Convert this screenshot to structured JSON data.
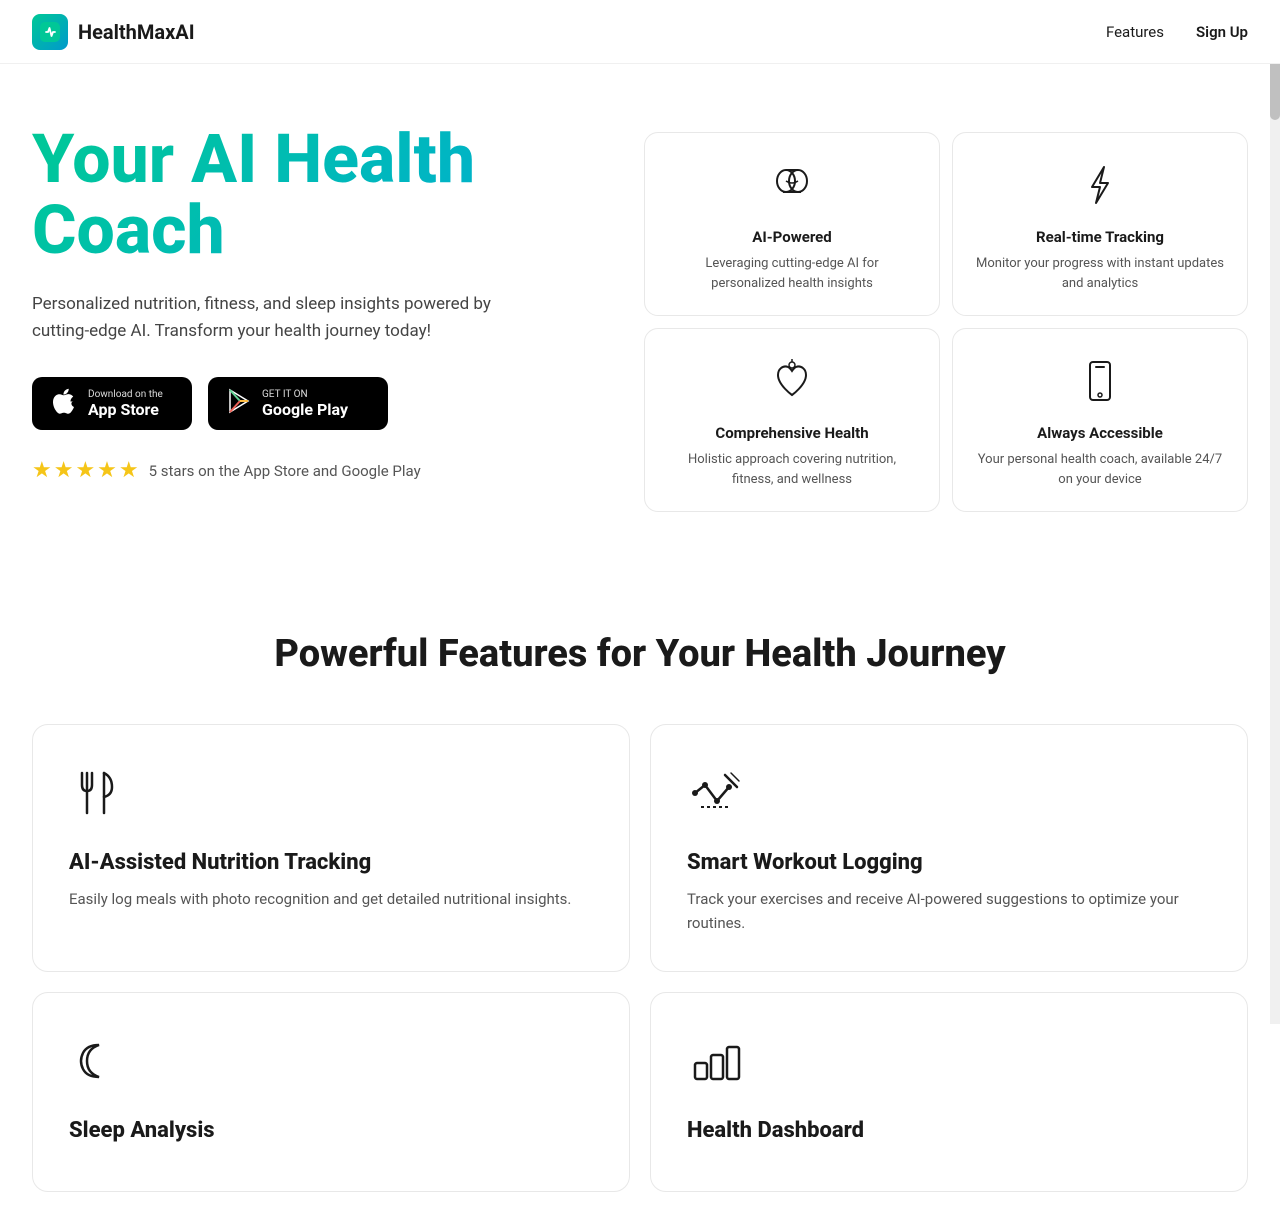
{
  "nav": {
    "logo_icon": "✦",
    "logo_text": "HealthMaxAI",
    "links": [
      {
        "label": "Features",
        "id": "nav-features"
      },
      {
        "label": "Sign Up",
        "id": "nav-signup"
      }
    ]
  },
  "hero": {
    "title": "Your AI Health Coach",
    "description": "Personalized nutrition, fitness, and sleep insights powered by cutting-edge AI. Transform your health journey today!",
    "appstore_sub": "Download on the",
    "appstore_main": "App Store",
    "googleplay_sub": "GET IT ON",
    "googleplay_main": "Google Play",
    "stars_count": "5 stars on the App Store and Google Play"
  },
  "feature_cards": [
    {
      "icon": "🧠",
      "title": "AI-Powered",
      "desc": "Leveraging cutting-edge AI for personalized health insights"
    },
    {
      "icon": "⚡",
      "title": "Real-time Tracking",
      "desc": "Monitor your progress with instant updates and analytics"
    },
    {
      "icon": "🍎",
      "title": "Comprehensive Health",
      "desc": "Holistic approach covering nutrition, fitness, and wellness"
    },
    {
      "icon": "📱",
      "title": "Always Accessible",
      "desc": "Your personal health coach, available 24/7 on your device"
    }
  ],
  "features_section": {
    "title": "Powerful Features for Your Health Journey",
    "cards": [
      {
        "icon": "🍴",
        "title": "AI-Assisted Nutrition Tracking",
        "desc": "Easily log meals with photo recognition and get detailed nutritional insights."
      },
      {
        "icon": "🔧",
        "title": "Smart Workout Logging",
        "desc": "Track your exercises and receive AI-powered suggestions to optimize your routines."
      },
      {
        "icon": "🌙",
        "title": "Sleep Analysis",
        "desc": ""
      },
      {
        "icon": "📊",
        "title": "Health Dashboard",
        "desc": ""
      }
    ]
  }
}
